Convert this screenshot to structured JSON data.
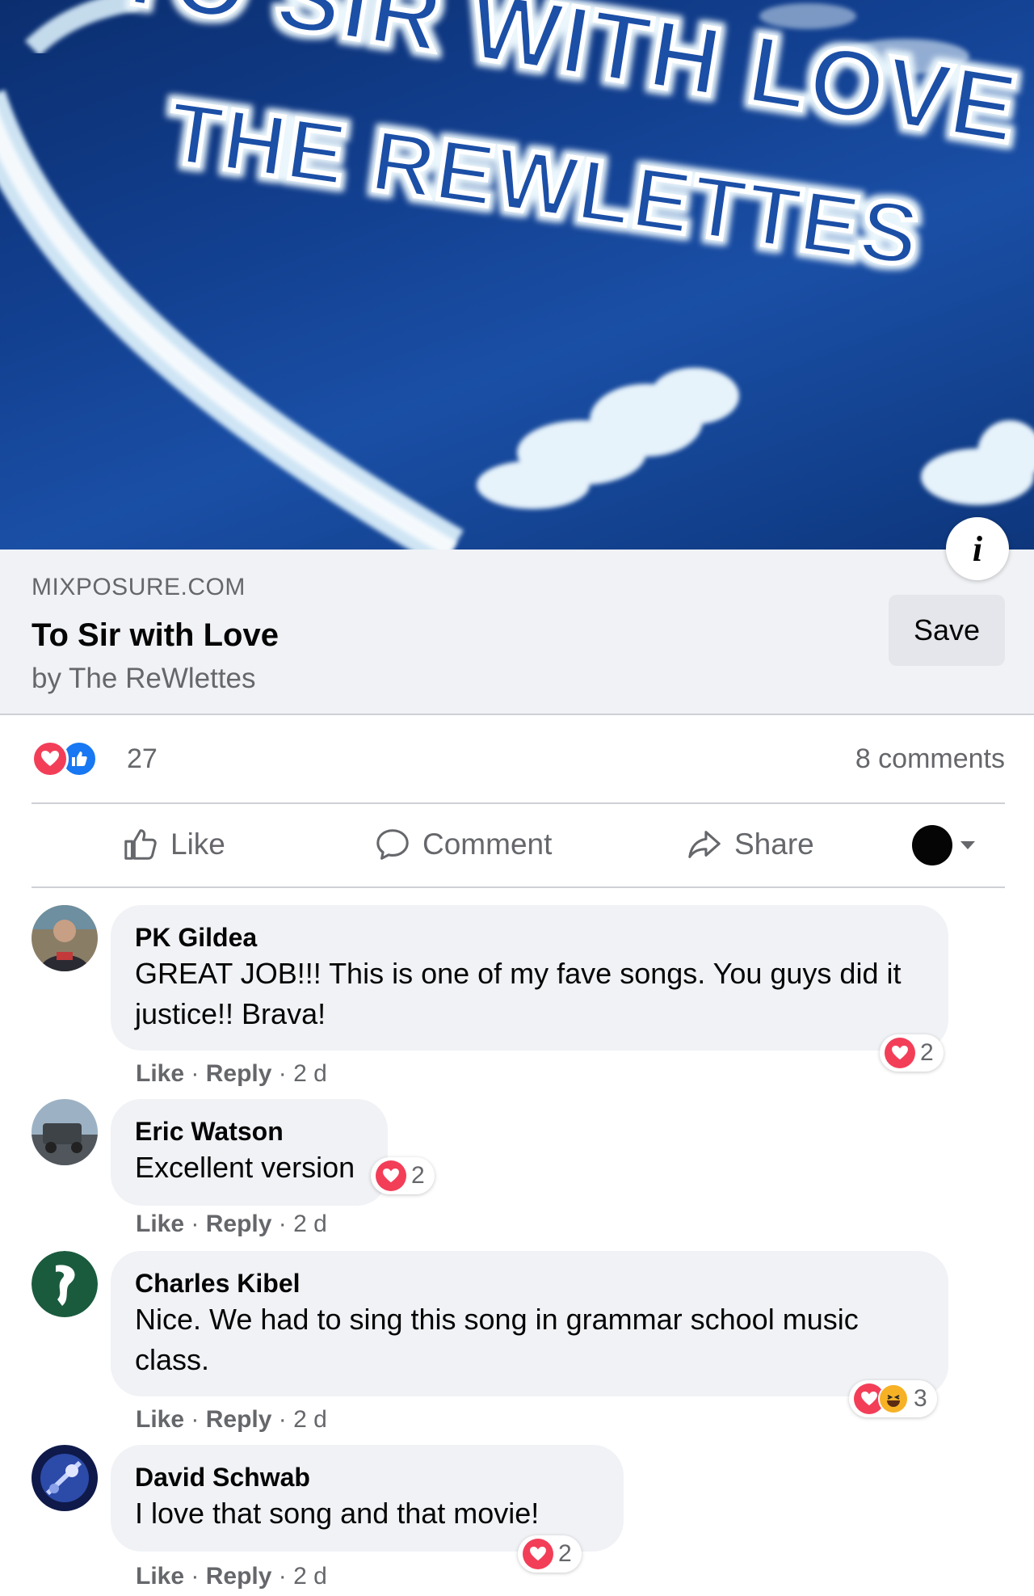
{
  "preview": {
    "image_text_line1": "TO SIR WITH LOVE",
    "image_text_line2": "THE REWLETTES",
    "image_colors": {
      "sky": "#123f8f",
      "cloud": "#e6f3fb"
    }
  },
  "link": {
    "domain": "MIXPOSURE.COM",
    "title": "To Sir with Love",
    "subtitle": "by The ReWlettes",
    "save_label": "Save",
    "info_icon": "i"
  },
  "stats": {
    "reaction_count": "27",
    "comment_count": "8 comments",
    "reaction_icons": [
      "love-icon",
      "like-icon"
    ],
    "colors": {
      "love": "#f33e58",
      "like": "#1877f2"
    }
  },
  "actions": {
    "like": "Like",
    "comment": "Comment",
    "share": "Share"
  },
  "comments": [
    {
      "name": "PK Gildea",
      "text": "GREAT JOB!!! This is one of my fave songs. You guys did it justice!! Brava!",
      "like": "Like",
      "reply": "Reply",
      "time": "2 d",
      "reactions": "2"
    },
    {
      "name": "Eric Watson",
      "text": "Excellent version",
      "like": "Like",
      "reply": "Reply",
      "time": "2 d",
      "reactions": "2"
    },
    {
      "name": "Charles Kibel",
      "text": "Nice. We had to sing this song in grammar school music class.",
      "like": "Like",
      "reply": "Reply",
      "time": "2 d",
      "reactions": "3"
    },
    {
      "name": "David Schwab",
      "text": "I love that song and that movie!",
      "like": "Like",
      "reply": "Reply",
      "time": "2 d",
      "reactions": "2"
    }
  ],
  "meta_separator": "·"
}
